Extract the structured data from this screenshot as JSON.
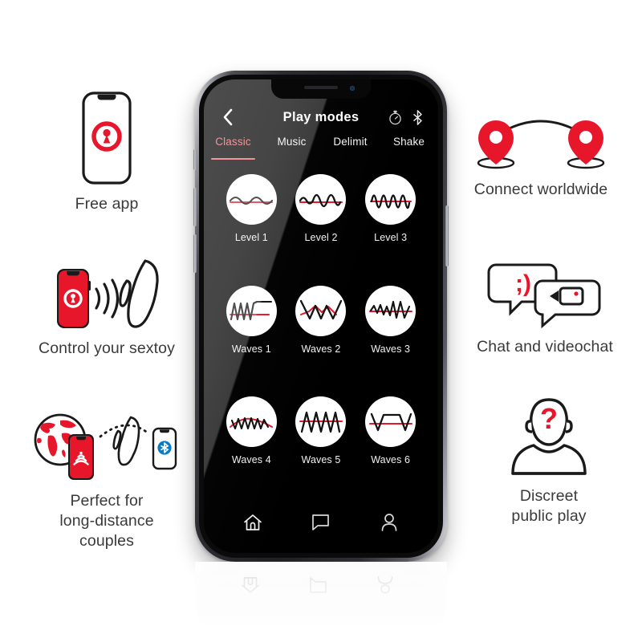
{
  "colors": {
    "brand_red": "#E8162B",
    "accent_salmon": "#EF6A6F",
    "caption_gray": "#3A3A3C",
    "screen_black": "#000000",
    "bluetooth_blue": "#0A7CC4"
  },
  "app": {
    "title": "Play modes",
    "back_icon": "chevron-left-icon",
    "header_icons": [
      {
        "name": "timer-icon",
        "label": "Timer"
      },
      {
        "name": "bluetooth-icon",
        "label": "Bluetooth"
      }
    ],
    "tabs": [
      {
        "label": "Classic",
        "active": true
      },
      {
        "label": "Music",
        "active": false
      },
      {
        "label": "Delimit",
        "active": false
      },
      {
        "label": "Shake",
        "active": false
      }
    ],
    "modes": [
      {
        "label": "Level 1",
        "wave": "sine-low"
      },
      {
        "label": "Level 2",
        "wave": "sine-mid"
      },
      {
        "label": "Level 3",
        "wave": "sine-high"
      },
      {
        "label": "Waves 1",
        "wave": "zigzag-ramp"
      },
      {
        "label": "Waves 2",
        "wave": "big-vw"
      },
      {
        "label": "Waves 3",
        "wave": "zigzag-rising"
      },
      {
        "label": "Waves 4",
        "wave": "zigzag-small"
      },
      {
        "label": "Waves 5",
        "wave": "triangle-tall"
      },
      {
        "label": "Waves 6",
        "wave": "trapezoid-pulse"
      }
    ],
    "nav": [
      {
        "name": "home-icon",
        "label": "Home"
      },
      {
        "name": "chat-icon",
        "label": "Chat"
      },
      {
        "name": "profile-icon",
        "label": "Profile"
      }
    ]
  },
  "features": {
    "free_app": {
      "caption": "Free app",
      "art": "phone-with-app-logo-icon"
    },
    "control_toy": {
      "caption": "Control your sextoy",
      "art": "red-phone-signal-toy-icon"
    },
    "long_distance": {
      "caption": "Perfect for\nlong-distance\ncouples",
      "art": "globe-phone-toy-bluetooth-icon"
    },
    "connect_worldwide": {
      "caption": "Connect worldwide",
      "art": "two-map-pins-arc-icon"
    },
    "chat_videochat": {
      "caption": "Chat and videochat",
      "art": "speech-bubbles-camera-icon",
      "emoticon": ";)"
    },
    "discreet_play": {
      "caption": "Discreet\npublic play",
      "art": "anonymous-person-question-icon",
      "question_mark": "?"
    }
  }
}
